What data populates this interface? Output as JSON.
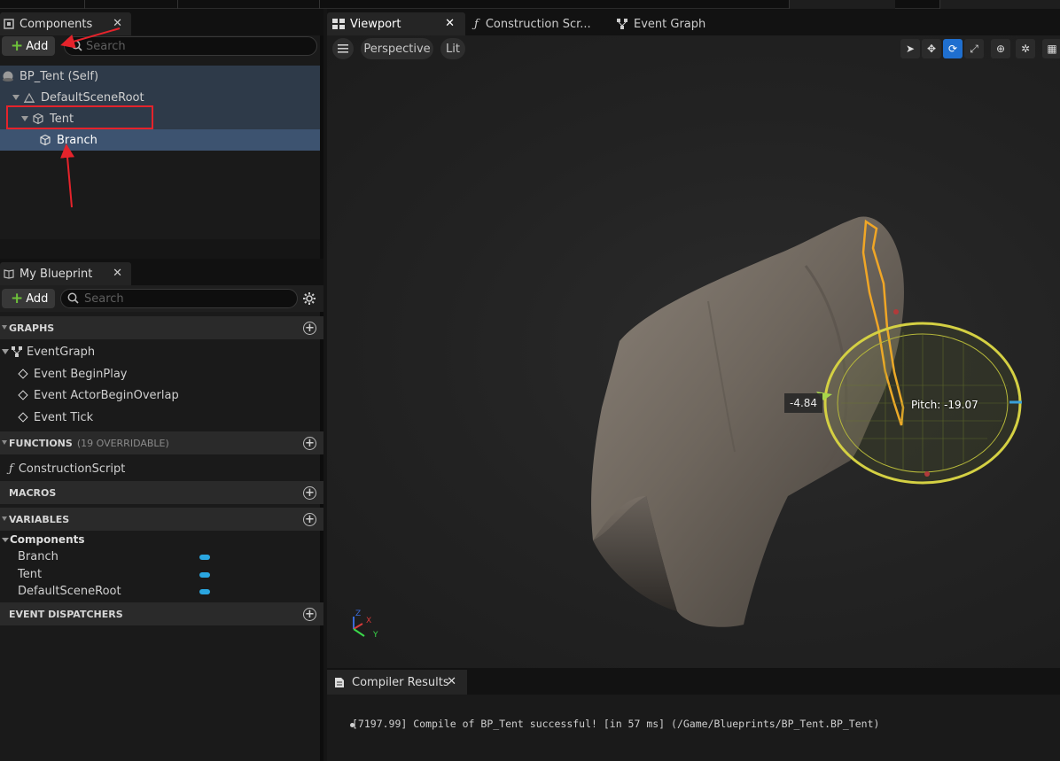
{
  "components_panel": {
    "tab_label": "Components",
    "add_label": "Add",
    "search_placeholder": "Search",
    "tree": [
      {
        "label": "BP_Tent (Self)"
      },
      {
        "label": "DefaultSceneRoot"
      },
      {
        "label": "Tent"
      },
      {
        "label": "Branch"
      }
    ]
  },
  "my_blueprint": {
    "tab_label": "My Blueprint",
    "add_label": "Add",
    "search_placeholder": "Search",
    "sections": {
      "graphs": "GRAPHS",
      "functions": "FUNCTIONS",
      "functions_note": "(19 OVERRIDABLE)",
      "macros": "MACROS",
      "variables": "VARIABLES",
      "dispatchers": "EVENT DISPATCHERS"
    },
    "graphs": {
      "root": "EventGraph",
      "events": [
        "Event BeginPlay",
        "Event ActorBeginOverlap",
        "Event Tick"
      ]
    },
    "functions": [
      "ConstructionScript"
    ],
    "variables": {
      "category": "Components",
      "items": [
        "Branch",
        "Tent",
        "DefaultSceneRoot"
      ],
      "type_color": "#2aa6e0"
    }
  },
  "editor_tabs": [
    {
      "label": "Viewport"
    },
    {
      "label": "Construction Scr..."
    },
    {
      "label": "Event Graph"
    }
  ],
  "viewport": {
    "perspective_label": "Perspective",
    "lit_label": "Lit",
    "rotation_readout": "-4.84",
    "pitch_readout": "Pitch: -19.07",
    "axis_x": "X",
    "axis_y": "Y",
    "axis_z": "Z"
  },
  "compiler": {
    "tab_label": "Compiler Results",
    "message": "[7197.99] Compile of BP_Tent successful! [in 57 ms] (/Game/Blueprints/BP_Tent.BP_Tent)"
  },
  "colors": {
    "accent_blue": "#1f6fcf",
    "selection": "#3d5370",
    "annotation_red": "#e5232b",
    "add_green": "#6ec13a"
  }
}
